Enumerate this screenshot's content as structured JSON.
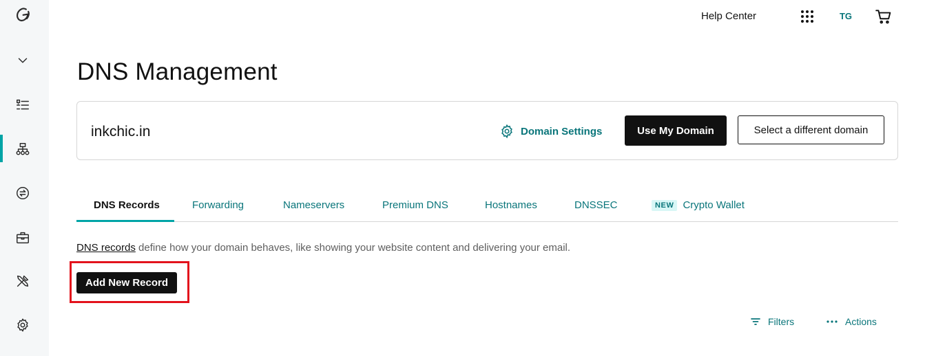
{
  "header": {
    "help_center": "Help Center",
    "avatar_initials": "TG"
  },
  "sidebar": {
    "items": [
      {
        "icon": "godaddy-logo-icon"
      },
      {
        "icon": "chevron-down-icon"
      },
      {
        "icon": "list-icon"
      },
      {
        "icon": "dns-sitemap-icon",
        "active": true
      },
      {
        "icon": "transfer-icon"
      },
      {
        "icon": "briefcase-icon"
      },
      {
        "icon": "tools-icon"
      },
      {
        "icon": "settings-icon"
      }
    ]
  },
  "page": {
    "title": "DNS Management"
  },
  "domain_card": {
    "domain": "inkchic.in",
    "settings_label": "Domain Settings",
    "use_domain_label": "Use My Domain",
    "select_domain_label": "Select a different domain"
  },
  "tabs": [
    {
      "label": "DNS Records",
      "active": true
    },
    {
      "label": "Forwarding"
    },
    {
      "label": "Nameservers"
    },
    {
      "label": "Premium DNS"
    },
    {
      "label": "Hostnames"
    },
    {
      "label": "DNSSEC"
    },
    {
      "label": "Crypto Wallet",
      "badge": "NEW"
    }
  ],
  "content": {
    "desc_link": "DNS records",
    "desc_text": " define how your domain behaves, like showing your website content and delivering your email.",
    "add_record_label": "Add New Record",
    "filters_label": "Filters",
    "actions_label": "Actions"
  },
  "colors": {
    "accent": "#09757a",
    "active_bar": "#00a4a6",
    "highlight": "#e3121c",
    "sidebar_bg": "#f5f7f8"
  }
}
